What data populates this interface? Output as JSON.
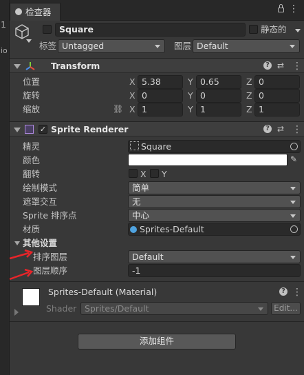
{
  "window": {
    "tab_title": "检查器",
    "left_fragment_1": "1",
    "left_fragment_2": "io"
  },
  "object": {
    "name": "Square",
    "static_label": "静态的",
    "tag_label": "标签",
    "tag_value": "Untagged",
    "layer_label": "图层",
    "layer_value": "Default"
  },
  "transform": {
    "title": "Transform",
    "position_label": "位置",
    "rotation_label": "旋转",
    "scale_label": "缩放",
    "axis_x": "X",
    "axis_y": "Y",
    "axis_z": "Z",
    "position": {
      "x": "5.38",
      "y": "0.65",
      "z": "0"
    },
    "rotation": {
      "x": "0",
      "y": "0",
      "z": "0"
    },
    "scale": {
      "x": "1",
      "y": "1",
      "z": "1"
    }
  },
  "sprite_renderer": {
    "title": "Sprite Renderer",
    "sprite_label": "精灵",
    "sprite_value": "Square",
    "color_label": "颜色",
    "color_value": "#ffffff",
    "flip_label": "翻转",
    "flip_x": "X",
    "flip_y": "Y",
    "draw_mode_label": "绘制模式",
    "draw_mode_value": "简单",
    "mask_label": "遮罩交互",
    "mask_value": "无",
    "sort_point_label": "Sprite 排序点",
    "sort_point_value": "中心",
    "material_label": "材质",
    "material_value": "Sprites-Default",
    "additional_label": "其他设置",
    "sorting_layer_label": "排序图层",
    "sorting_layer_value": "Default",
    "order_label": "图层顺序",
    "order_value": "-1"
  },
  "material": {
    "title": "Sprites-Default (Material)",
    "shader_label": "Shader",
    "shader_value": "Sprites/Default",
    "edit_label": "Edit..."
  },
  "add_component_label": "添加组件",
  "annotation_color": "#e8252a"
}
